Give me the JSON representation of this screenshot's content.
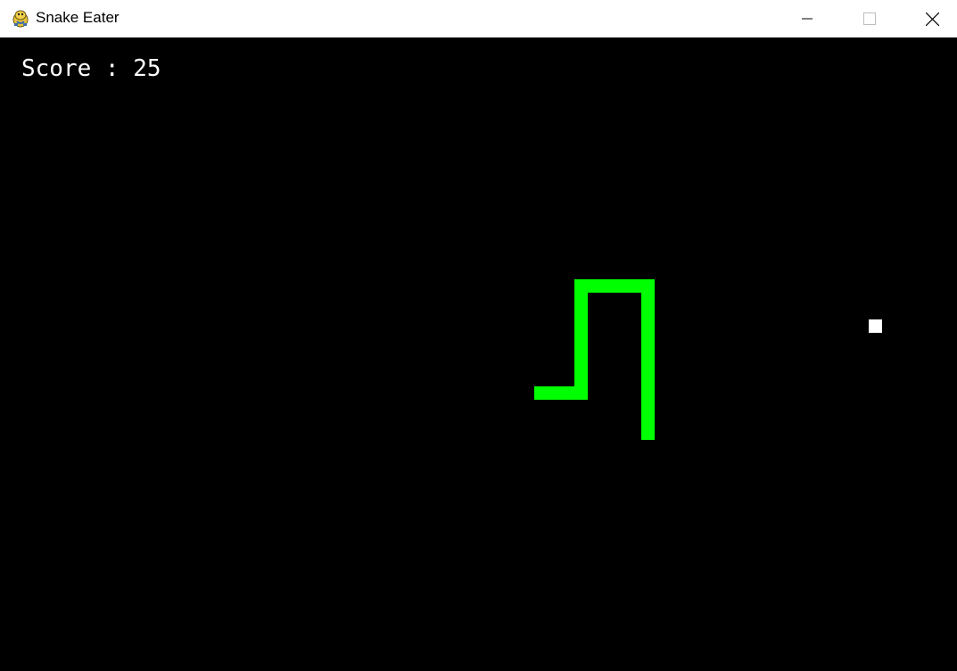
{
  "window": {
    "title": "Snake Eater",
    "app_icon": "pygame-snake-icon"
  },
  "controls": {
    "minimize_icon": "minimize-icon",
    "maximize_icon": "maximize-icon",
    "close_icon": "close-icon"
  },
  "game": {
    "score_text": "Score : 25",
    "score": 25,
    "background_color": "#000000",
    "snake_color": "#00ff00",
    "food_color": "#ffffff"
  }
}
